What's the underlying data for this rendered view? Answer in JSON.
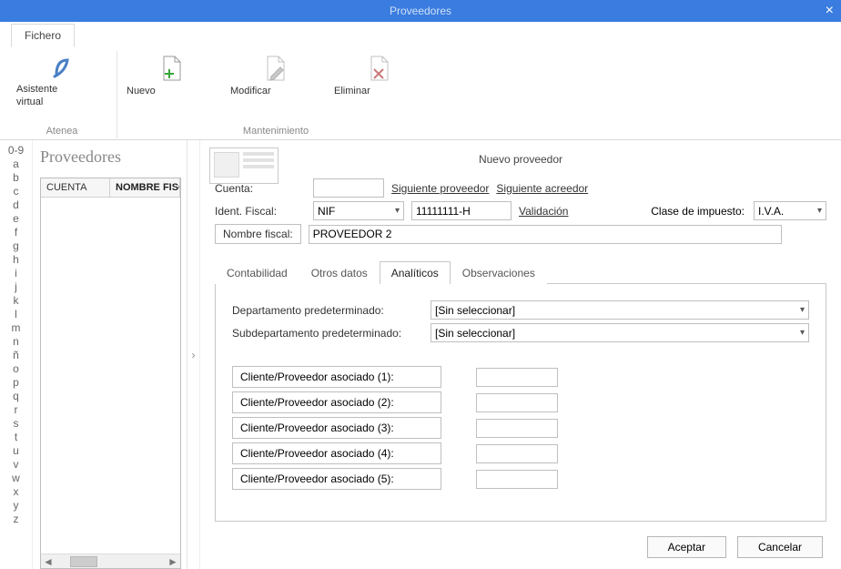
{
  "titlebar": {
    "title": "Proveedores"
  },
  "ribbon": {
    "tab": "Fichero",
    "assistant": {
      "line1": "Asistente",
      "line2": "virtual",
      "line3": "Atenea"
    },
    "maintenance": {
      "caption": "Mantenimiento",
      "new": "Nuevo",
      "modify": "Modificar",
      "delete": "Eliminar"
    }
  },
  "alpha": [
    "0-9",
    "a",
    "b",
    "c",
    "d",
    "e",
    "f",
    "g",
    "h",
    "i",
    "j",
    "k",
    "l",
    "m",
    "n",
    "ñ",
    "o",
    "p",
    "q",
    "r",
    "s",
    "t",
    "u",
    "v",
    "w",
    "x",
    "y",
    "z"
  ],
  "leftPane": {
    "title": "Proveedores",
    "columns": {
      "cuenta": "CUENTA",
      "nombre": "NOMBRE FISCAL"
    }
  },
  "form": {
    "title": "Nuevo proveedor",
    "labels": {
      "cuenta": "Cuenta:",
      "siguienteProveedor": "Siguiente proveedor",
      "siguienteAcreedor": "Siguiente acreedor",
      "identFiscal": "Ident. Fiscal:",
      "validacion": "Validación",
      "claseImpuesto": "Clase de impuesto:",
      "nombreFiscal": "Nombre fiscal:"
    },
    "values": {
      "cuenta": "",
      "identTipo": "NIF",
      "identNumero": "11111111-H",
      "claseImpuesto": "I.V.A.",
      "nombreFiscal": "PROVEEDOR 2"
    },
    "tabs": {
      "contabilidad": "Contabilidad",
      "otrosDatos": "Otros datos",
      "analiticos": "Analíticos",
      "observaciones": "Observaciones"
    },
    "analiticos": {
      "departamento": "Departamento predeterminado:",
      "departamentoValor": "[Sin seleccionar]",
      "subdepartamento": "Subdepartamento predeterminado:",
      "subdepartamentoValor": "[Sin seleccionar]",
      "asociados": [
        "Cliente/Proveedor asociado (1):",
        "Cliente/Proveedor asociado (2):",
        "Cliente/Proveedor asociado (3):",
        "Cliente/Proveedor asociado (4):",
        "Cliente/Proveedor asociado (5):"
      ]
    }
  },
  "buttons": {
    "accept": "Aceptar",
    "cancel": "Cancelar"
  }
}
